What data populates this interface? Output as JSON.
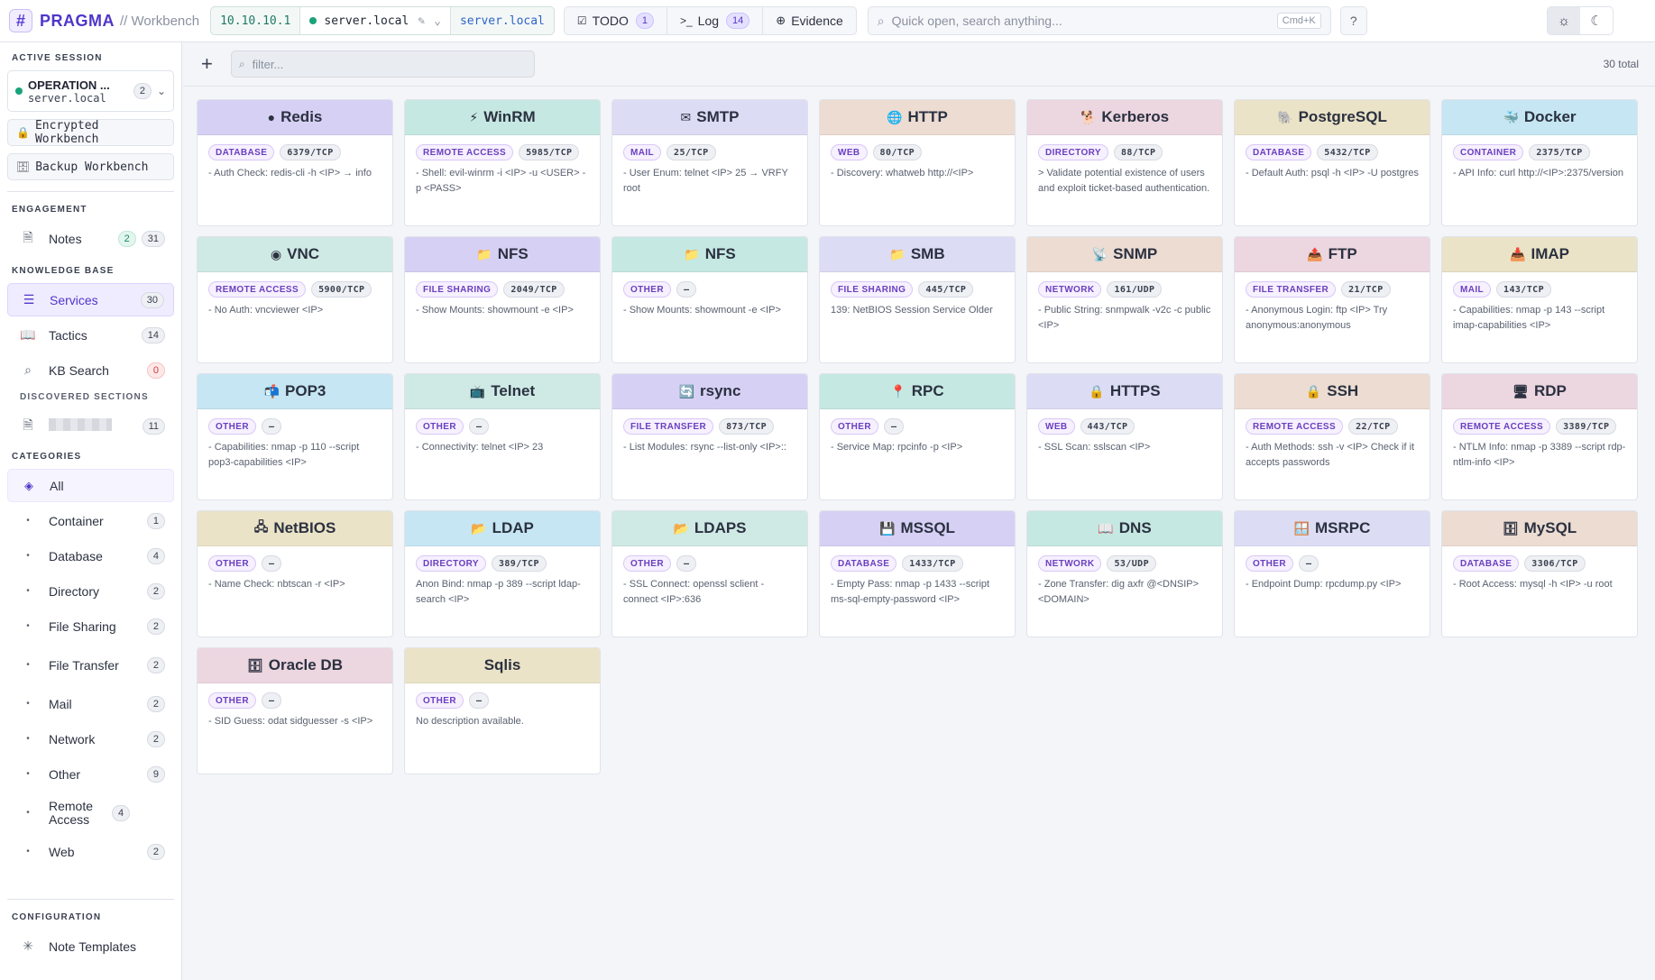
{
  "app": {
    "logo_glyph": "#",
    "brand": "PRAGMA",
    "brand_sub": "// Workbench"
  },
  "target": {
    "ip": "10.10.10.1",
    "host": "server.local",
    "host_alt": "server.local"
  },
  "toptabs": [
    {
      "icon": "☑",
      "label": "TODO",
      "count": "1"
    },
    {
      "icon": ">_",
      "label": "Log",
      "count": "14"
    },
    {
      "icon": "⊕",
      "label": "Evidence"
    }
  ],
  "search": {
    "placeholder": "Quick open, search anything...",
    "shortcut": "Cmd+K"
  },
  "help_label": "?",
  "sidebar": {
    "active_session_title": "ACTIVE SESSION",
    "session": {
      "name": "OPERATION ...",
      "host": "server.local",
      "count": "2"
    },
    "encrypted_label": "Encrypted Workbench",
    "backup_label": "Backup Workbench",
    "engagement_title": "ENGAGEMENT",
    "notes": {
      "label": "Notes",
      "badge1": "2",
      "badge2": "31"
    },
    "kb_title": "KNOWLEDGE BASE",
    "services": {
      "label": "Services",
      "count": "30"
    },
    "tactics": {
      "label": "Tactics",
      "count": "14"
    },
    "kbsearch": {
      "label": "KB Search",
      "count": "0"
    },
    "discovered_title": "DISCOVERED SECTIONS",
    "discovered_count": "11",
    "categories_title": "CATEGORIES",
    "categories": [
      {
        "label": "All",
        "count": ""
      },
      {
        "label": "Container",
        "count": "1"
      },
      {
        "label": "Database",
        "count": "4"
      },
      {
        "label": "Directory",
        "count": "2"
      },
      {
        "label": "File Sharing",
        "count": "2"
      },
      {
        "label": "File Transfer",
        "count": "2"
      },
      {
        "label": "Mail",
        "count": "2"
      },
      {
        "label": "Network",
        "count": "2"
      },
      {
        "label": "Other",
        "count": "9"
      },
      {
        "label": "Remote Access",
        "count": "4"
      },
      {
        "label": "Web",
        "count": "2"
      }
    ],
    "config_title": "CONFIGURATION",
    "note_templates": "Note Templates"
  },
  "main": {
    "filter_placeholder": "filter...",
    "total": "30 total"
  },
  "cards": [
    {
      "icon": "●",
      "name": "Redis",
      "cat": "DATABASE",
      "port": "6379/TCP",
      "desc": "- Auth Check: redis-cli -h <IP> → info",
      "color": "purple"
    },
    {
      "icon": "⚡",
      "name": "WinRM",
      "cat": "REMOTE ACCESS",
      "port": "5985/TCP",
      "desc": "- Shell: evil-winrm -i <IP> -u <USER> -p <PASS>",
      "color": "teal"
    },
    {
      "icon": "✉",
      "name": "SMTP",
      "cat": "MAIL",
      "port": "25/TCP",
      "desc": "- User Enum: telnet <IP> 25 → VRFY root",
      "color": "lav"
    },
    {
      "icon": "🌐",
      "name": "HTTP",
      "cat": "WEB",
      "port": "80/TCP",
      "desc": "- Discovery: whatweb http://<IP>",
      "color": "tan"
    },
    {
      "icon": "🐕",
      "name": "Kerberos",
      "cat": "DIRECTORY",
      "port": "88/TCP",
      "desc": "> Validate potential existence of users and exploit ticket-based authentication.",
      "color": "pink"
    },
    {
      "icon": "🐘",
      "name": "PostgreSQL",
      "cat": "DATABASE",
      "port": "5432/TCP",
      "desc": "- Default Auth: psql -h <IP> -U postgres",
      "color": "khaki"
    },
    {
      "icon": "🐳",
      "name": "Docker",
      "cat": "CONTAINER",
      "port": "2375/TCP",
      "desc": "- API Info: curl http://<IP>:2375/version",
      "color": "blue"
    },
    {
      "icon": "◉",
      "name": "VNC",
      "cat": "REMOTE ACCESS",
      "port": "5900/TCP",
      "desc": "- No Auth: vncviewer <IP>",
      "color": "mint"
    },
    {
      "icon": "📁",
      "name": "NFS",
      "cat": "FILE SHARING",
      "port": "2049/TCP",
      "desc": "- Show Mounts: showmount -e <IP>",
      "color": "purple"
    },
    {
      "icon": "📁",
      "name": "NFS",
      "cat": "OTHER",
      "port": "—",
      "desc": "- Show Mounts: showmount -e <IP>",
      "color": "teal"
    },
    {
      "icon": "📁",
      "name": "SMB",
      "cat": "FILE SHARING",
      "port": "445/TCP",
      "desc": "139: NetBIOS Session Service Older",
      "color": "lav"
    },
    {
      "icon": "📡",
      "name": "SNMP",
      "cat": "NETWORK",
      "port": "161/UDP",
      "desc": "- Public String: snmpwalk -v2c -c public <IP>",
      "color": "tan"
    },
    {
      "icon": "📤",
      "name": "FTP",
      "cat": "FILE TRANSFER",
      "port": "21/TCP",
      "desc": "- Anonymous Login: ftp <IP> Try anonymous:anonymous",
      "color": "pink"
    },
    {
      "icon": "📥",
      "name": "IMAP",
      "cat": "MAIL",
      "port": "143/TCP",
      "desc": "- Capabilities: nmap -p 143 --script imap-capabilities <IP>",
      "color": "khaki"
    },
    {
      "icon": "📬",
      "name": "POP3",
      "cat": "OTHER",
      "port": "—",
      "desc": "- Capabilities: nmap -p 110 --script pop3-capabilities <IP>",
      "color": "blue"
    },
    {
      "icon": "📺",
      "name": "Telnet",
      "cat": "OTHER",
      "port": "—",
      "desc": "- Connectivity: telnet <IP> 23",
      "color": "mint"
    },
    {
      "icon": "🔄",
      "name": "rsync",
      "cat": "FILE TRANSFER",
      "port": "873/TCP",
      "desc": "- List Modules: rsync --list-only <IP>::",
      "color": "purple"
    },
    {
      "icon": "📍",
      "name": "RPC",
      "cat": "OTHER",
      "port": "—",
      "desc": "- Service Map: rpcinfo -p <IP>",
      "color": "teal"
    },
    {
      "icon": "🔒",
      "name": "HTTPS",
      "cat": "WEB",
      "port": "443/TCP",
      "desc": "- SSL Scan: sslscan <IP>",
      "color": "lav"
    },
    {
      "icon": "🔒",
      "name": "SSH",
      "cat": "REMOTE ACCESS",
      "port": "22/TCP",
      "desc": "- Auth Methods: ssh -v <IP> Check if it accepts passwords",
      "color": "tan"
    },
    {
      "icon": "🖥",
      "name": "RDP",
      "cat": "REMOTE ACCESS",
      "port": "3389/TCP",
      "desc": "- NTLM Info: nmap -p 3389 --script rdp-ntlm-info <IP>",
      "color": "pink"
    },
    {
      "icon": "🖧",
      "name": "NetBIOS",
      "cat": "OTHER",
      "port": "—",
      "desc": "- Name Check: nbtscan -r <IP>",
      "color": "khaki"
    },
    {
      "icon": "📂",
      "name": "LDAP",
      "cat": "DIRECTORY",
      "port": "389/TCP",
      "desc": "Anon Bind: nmap -p 389 --script ldap-search <IP>",
      "color": "blue"
    },
    {
      "icon": "📂",
      "name": "LDAPS",
      "cat": "OTHER",
      "port": "—",
      "desc": "- SSL Connect: openssl sclient -connect <IP>:636",
      "color": "mint"
    },
    {
      "icon": "💾",
      "name": "MSSQL",
      "cat": "DATABASE",
      "port": "1433/TCP",
      "desc": "- Empty Pass: nmap -p 1433 --script ms-sql-empty-password <IP>",
      "color": "purple"
    },
    {
      "icon": "📖",
      "name": "DNS",
      "cat": "NETWORK",
      "port": "53/UDP",
      "desc": "- Zone Transfer: dig axfr @<DNSIP> <DOMAIN>",
      "color": "teal"
    },
    {
      "icon": "🪟",
      "name": "MSRPC",
      "cat": "OTHER",
      "port": "—",
      "desc": "- Endpoint Dump: rpcdump.py <IP>",
      "color": "lav"
    },
    {
      "icon": "🗄",
      "name": "MySQL",
      "cat": "DATABASE",
      "port": "3306/TCP",
      "desc": "- Root Access: mysql -h <IP> -u root",
      "color": "tan"
    },
    {
      "icon": "🗄",
      "name": "Oracle DB",
      "cat": "OTHER",
      "port": "—",
      "desc": "- SID Guess: odat sidguesser -s <IP>",
      "color": "pink"
    },
    {
      "icon": "",
      "name": "Sqlis",
      "cat": "OTHER",
      "port": "—",
      "desc": "No description available.",
      "color": "khaki"
    }
  ]
}
